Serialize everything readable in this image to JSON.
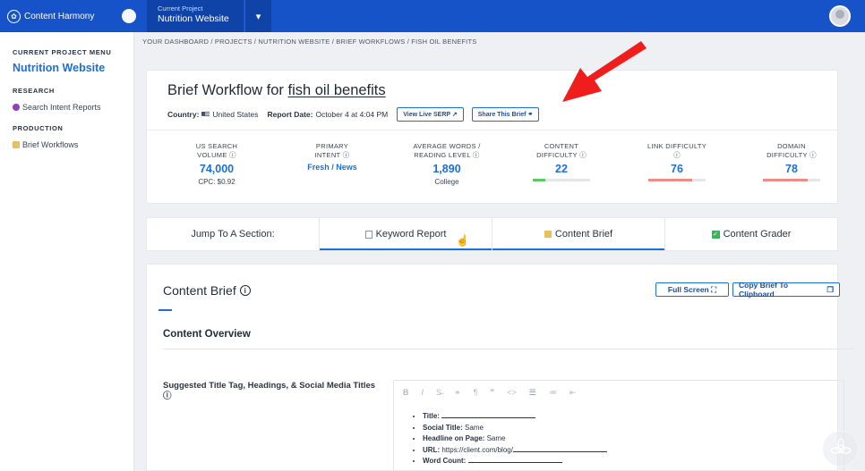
{
  "app": {
    "name": "Content Harmony"
  },
  "project": {
    "label": "Current Project",
    "name": "Nutrition Website"
  },
  "sidebar": {
    "menu_heading": "CURRENT PROJECT MENU",
    "project_name": "Nutrition Website",
    "research_heading": "RESEARCH",
    "research_item": "Search Intent Reports",
    "production_heading": "PRODUCTION",
    "production_item": "Brief Workflows"
  },
  "breadcrumb": "YOUR DASHBOARD / PROJECTS / NUTRITION WEBSITE / BRIEF WORKFLOWS / FISH OIL BENEFITS",
  "brief": {
    "title_prefix": "Brief Workflow for ",
    "keyword": "fish oil benefits",
    "country_label": "Country:",
    "country": "United States",
    "date_label": "Report Date:",
    "date": "October 4 at 4:04 PM",
    "serp_button": "View Live SERP",
    "share_button": "Share This Brief"
  },
  "metrics": [
    {
      "label": "US SEARCH VOLUME",
      "value": "74,000",
      "sub": "CPC: $0.92"
    },
    {
      "label": "PRIMARY INTENT",
      "value": "Fresh / News"
    },
    {
      "label": "AVERAGE WORDS / READING LEVEL",
      "value": "1,890",
      "sub": "College"
    },
    {
      "label": "CONTENT DIFFICULTY",
      "value": "22",
      "bar": 0.22,
      "bar_color": "#5cc860"
    },
    {
      "label": "LINK DIFFICULTY",
      "value": "76",
      "bar": 0.76,
      "bar_color": "#f08a85"
    },
    {
      "label": "DOMAIN DIFFICULTY",
      "value": "78",
      "bar": 0.78,
      "bar_color": "#f08a85"
    }
  ],
  "tabs": {
    "jump_label": "Jump To A Section:",
    "keyword_report": "Keyword Report",
    "content_brief": "Content Brief",
    "content_grader": "Content Grader"
  },
  "content_brief": {
    "title": "Content Brief",
    "full_screen": "Full Screen",
    "copy": "Copy Brief To Clipboard",
    "overview": "Content Overview",
    "suggested_title": "Suggested Title Tag, Headings, & Social Media Titles",
    "list": {
      "title_label": "Title:",
      "social_label": "Social Title:",
      "social_value": "Same",
      "headline_label": "Headline on Page:",
      "headline_value": "Same",
      "url_label": "URL:",
      "url_value": "https://client.com/blog/",
      "wordcount_label": "Word Count:"
    }
  },
  "colors": {
    "topbar": "#1652c8",
    "accent": "#1b6fd8",
    "arrow": "#f01d1d"
  }
}
